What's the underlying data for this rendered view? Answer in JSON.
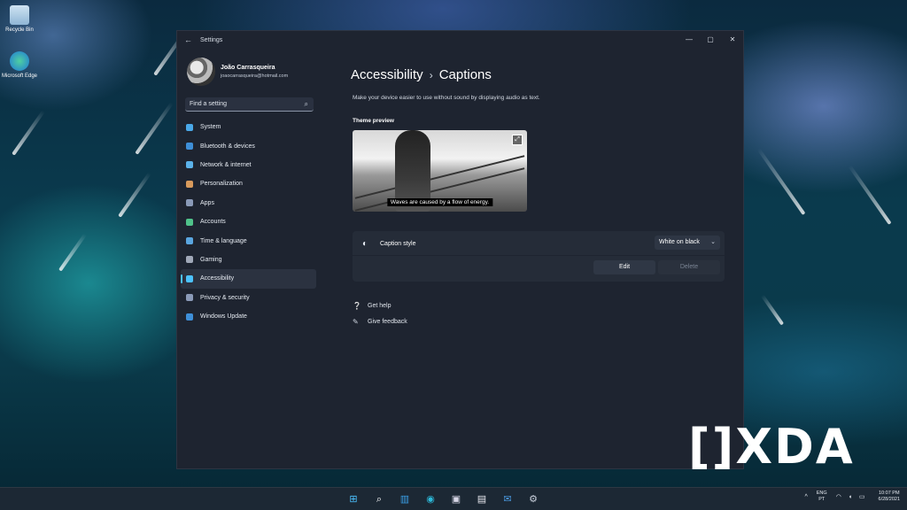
{
  "desktop": {
    "icons": [
      {
        "label": "Recycle Bin",
        "icon": "recycle-bin-icon"
      },
      {
        "label": "Microsoft Edge",
        "icon": "edge-icon"
      }
    ]
  },
  "window": {
    "back_glyph": "←",
    "title": "Settings",
    "controls": {
      "minimize": "—",
      "maximize": "▢",
      "close": "✕"
    }
  },
  "profile": {
    "name": "João Carrasqueira",
    "email": "joaocarrasqueira@hotmail.com"
  },
  "search": {
    "placeholder": "Find a setting",
    "icon": "⌕"
  },
  "nav": {
    "items": [
      {
        "label": "System",
        "color": "#4aa8e8"
      },
      {
        "label": "Bluetooth & devices",
        "color": "#3e8fd8"
      },
      {
        "label": "Network & internet",
        "color": "#5bb2ea"
      },
      {
        "label": "Personalization",
        "color": "#d89a5c"
      },
      {
        "label": "Apps",
        "color": "#8a9ab8"
      },
      {
        "label": "Accounts",
        "color": "#4fc28a"
      },
      {
        "label": "Time & language",
        "color": "#5aa6e0"
      },
      {
        "label": "Gaming",
        "color": "#a0a8b8"
      },
      {
        "label": "Accessibility",
        "color": "#4cc2ff"
      },
      {
        "label": "Privacy & security",
        "color": "#8a9ab8"
      },
      {
        "label": "Windows Update",
        "color": "#3e8fd8"
      }
    ],
    "active_index": 8
  },
  "content": {
    "breadcrumb_parent": "Accessibility",
    "breadcrumb_sep": "›",
    "breadcrumb_current": "Captions",
    "description": "Make your device easier to use without sound by displaying audio as text.",
    "preview_label": "Theme preview",
    "preview_caption": "Waves are caused by a flow of energy.",
    "caption_style_label": "Caption style",
    "caption_style_value": "White on black",
    "dropdown_chevron": "⌄",
    "edit_label": "Edit",
    "delete_label": "Delete",
    "links": [
      {
        "label": "Get help",
        "icon": "help-icon",
        "glyph": "❔"
      },
      {
        "label": "Give feedback",
        "icon": "feedback-icon",
        "glyph": "✎"
      }
    ]
  },
  "watermark": "[]XDA",
  "taskbar": {
    "icons": [
      {
        "name": "start-icon",
        "glyph": "⊞",
        "color": "#4cc2ff"
      },
      {
        "name": "search-icon",
        "glyph": "⌕",
        "color": "#ffffff"
      },
      {
        "name": "widgets-icon",
        "glyph": "▥",
        "color": "#3aa0e8"
      },
      {
        "name": "edge-icon",
        "glyph": "◉",
        "color": "#2cb8d8"
      },
      {
        "name": "photos-icon",
        "glyph": "▣",
        "color": "#d8d8e8"
      },
      {
        "name": "store-icon",
        "glyph": "▤",
        "color": "#e8e8f0"
      },
      {
        "name": "mail-icon",
        "glyph": "✉",
        "color": "#4a9ae0"
      },
      {
        "name": "settings-icon",
        "glyph": "⚙",
        "color": "#c8d0dc"
      }
    ],
    "tray_chevron": "^",
    "lang_line1": "ENG",
    "lang_line2": "PT",
    "sys_icons": "◠ ◖ ▭",
    "time": "10:07 PM",
    "date": "6/28/2021"
  }
}
